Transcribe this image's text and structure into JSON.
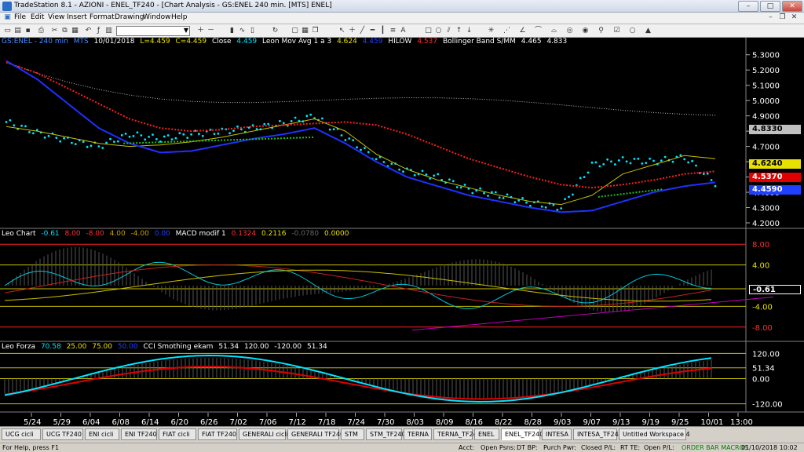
{
  "window": {
    "title": "TradeStation 8.1 - AZIONI - ENEL_TF240 - [Chart Analysis - GS:ENEL  240 min. [MTS] ENEL]"
  },
  "menu": [
    "File",
    "Edit",
    "View",
    "Insert",
    "Format",
    "Drawing",
    "Window",
    "Help"
  ],
  "toolbar": {
    "symbol_value": ""
  },
  "colors": {
    "bg": "#000000",
    "grid": "#333333",
    "price_dots": "#00e5ff",
    "ma_blue": "#2030ff",
    "ma_yellow": "#c8c000",
    "dots_red": "#ff2020",
    "dots_green": "#20c020",
    "upper_band": "#c8c8c8",
    "trend_magenta": "#c000c0"
  },
  "panel1": {
    "headers": [
      "GS:ENEL - 240 min",
      "MTS",
      "10/01/2018",
      "L=4.459",
      "C=4.459",
      "Close",
      "4.459",
      "Leon Mov Avg 1 a 3",
      "4.624",
      "4.459",
      "HILOW",
      "4.537",
      "Bollinger Band S/MM",
      "4.465",
      "4.833"
    ],
    "price_labels": [
      "5.3000",
      "5.2000",
      "5.1000",
      "5.0000",
      "4.9000",
      "4.8000",
      "4.7000",
      "4.6000",
      "4.5000",
      "4.4000",
      "4.3000",
      "4.2000"
    ],
    "tags": [
      {
        "text": "4.8330",
        "bg": "#c0c0c0",
        "fg": "#000000"
      },
      {
        "text": "4.6240",
        "bg": "#e8e000",
        "fg": "#000000"
      },
      {
        "text": "4.5370",
        "bg": "#e00000",
        "fg": "#ffffff"
      },
      {
        "text": "4.4590",
        "bg": "#2040ff",
        "fg": "#ffffff"
      }
    ]
  },
  "panel2": {
    "headers": [
      "Leo Chart",
      "-0.61",
      "8.00",
      "-8.00",
      "4.00",
      "-4.00",
      "0.00",
      "MACD modif 1",
      "0.1324",
      "0.2116",
      "-0.0780",
      "0.0000"
    ],
    "levels": [
      "8.00",
      "4.00",
      "-0.61",
      "-4.00",
      "-8.00"
    ]
  },
  "panel3": {
    "headers": [
      "Leo Forza",
      "70.58",
      "25.00",
      "75.00",
      "50.00",
      "CCI Smothing ekam",
      "51.34",
      "120.00",
      "-120.00",
      "51.34"
    ],
    "levels": [
      "120.00",
      "51.34",
      "0.00",
      "-120.00"
    ]
  },
  "dates": [
    "5/24",
    "5/29",
    "6/04",
    "6/08",
    "6/14",
    "6/20",
    "6/26",
    "7/02",
    "7/06",
    "7/12",
    "7/18",
    "7/24",
    "7/30",
    "8/03",
    "8/09",
    "8/16",
    "8/22",
    "8/28",
    "9/03",
    "9/07",
    "9/13",
    "9/19",
    "9/25",
    "10/01",
    "13:00"
  ],
  "chart_data": {
    "type": "line",
    "title": "",
    "x": [
      "5/24",
      "5/29",
      "6/04",
      "6/08",
      "6/14",
      "6/20",
      "6/26",
      "7/02",
      "7/06",
      "7/12",
      "7/18",
      "7/24",
      "7/30",
      "8/03",
      "8/09",
      "8/16",
      "8/22",
      "8/28",
      "9/03",
      "9/07",
      "9/13",
      "9/19",
      "9/25",
      "10/01"
    ],
    "ylim": [
      4.2,
      5.35
    ],
    "series": [
      {
        "name": "Close",
        "values": [
          4.86,
          4.79,
          4.74,
          4.7,
          4.78,
          4.75,
          4.78,
          4.8,
          4.82,
          4.85,
          4.9,
          4.76,
          4.62,
          4.54,
          4.5,
          4.42,
          4.38,
          4.33,
          4.3,
          4.58,
          4.61,
          4.6,
          4.63,
          4.46
        ]
      },
      {
        "name": "Leon Mov Avg 1 a 3",
        "values": [
          4.83,
          4.8,
          4.76,
          4.72,
          4.7,
          4.71,
          4.73,
          4.76,
          4.8,
          4.84,
          4.88,
          4.8,
          4.65,
          4.55,
          4.48,
          4.43,
          4.38,
          4.34,
          4.32,
          4.38,
          4.52,
          4.58,
          4.64,
          4.62
        ]
      },
      {
        "name": "HILOW",
        "values": [
          5.25,
          5.18,
          5.08,
          4.98,
          4.88,
          4.82,
          4.8,
          4.81,
          4.83,
          4.84,
          4.85,
          4.86,
          4.84,
          4.78,
          4.7,
          4.62,
          4.56,
          4.5,
          4.45,
          4.43,
          4.45,
          4.48,
          4.52,
          4.537
        ]
      },
      {
        "name": "Bollinger Band S/MM",
        "values": [
          5.26,
          5.14,
          4.98,
          4.82,
          4.72,
          4.66,
          4.67,
          4.71,
          4.75,
          4.78,
          4.82,
          4.72,
          4.6,
          4.5,
          4.44,
          4.38,
          4.34,
          4.3,
          4.27,
          4.28,
          4.34,
          4.4,
          4.44,
          4.465
        ]
      }
    ]
  }
}
